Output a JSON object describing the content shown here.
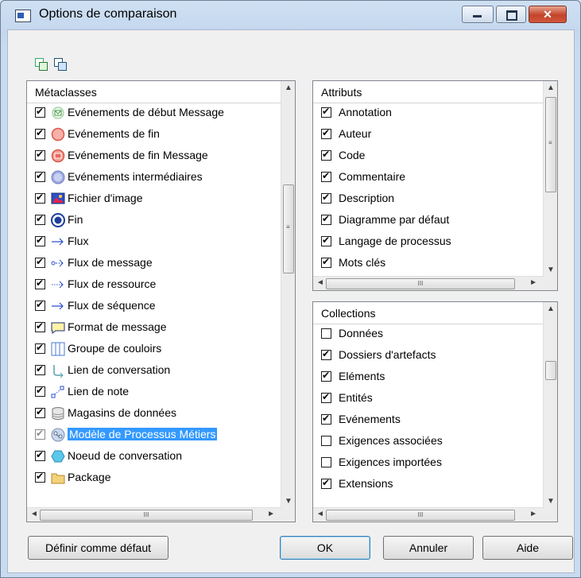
{
  "window": {
    "title": "Options de comparaison",
    "close_glyph": "✕"
  },
  "toolbar": {
    "icons": [
      "select-all-icon",
      "deselect-all-icon"
    ]
  },
  "metaclasses": {
    "header": "Métaclasses",
    "items": [
      {
        "label": "Evénements de début Message",
        "checked": true,
        "icon": "start-message-event-icon"
      },
      {
        "label": "Evénements de fin",
        "checked": true,
        "icon": "end-event-icon"
      },
      {
        "label": "Evénements de fin Message",
        "checked": true,
        "icon": "end-message-event-icon"
      },
      {
        "label": "Evénements intermédiaires",
        "checked": true,
        "icon": "intermediate-event-icon"
      },
      {
        "label": "Fichier d'image",
        "checked": true,
        "icon": "image-file-icon"
      },
      {
        "label": "Fin",
        "checked": true,
        "icon": "end-icon"
      },
      {
        "label": "Flux",
        "checked": true,
        "icon": "flow-arrow-icon"
      },
      {
        "label": "Flux de message",
        "checked": true,
        "icon": "message-flow-icon"
      },
      {
        "label": "Flux de ressource",
        "checked": true,
        "icon": "resource-flow-icon"
      },
      {
        "label": "Flux de séquence",
        "checked": true,
        "icon": "sequence-flow-icon"
      },
      {
        "label": "Format de message",
        "checked": true,
        "icon": "message-format-icon"
      },
      {
        "label": "Groupe de couloirs",
        "checked": true,
        "icon": "swimlane-group-icon"
      },
      {
        "label": "Lien de conversation",
        "checked": true,
        "icon": "conversation-link-icon"
      },
      {
        "label": "Lien de note",
        "checked": true,
        "icon": "note-link-icon"
      },
      {
        "label": "Magasins de données",
        "checked": true,
        "icon": "data-store-icon"
      },
      {
        "label": "Modèle de Processus Métiers",
        "checked": true,
        "icon": "business-process-model-icon"
      },
      {
        "label": "Noeud de conversation",
        "checked": true,
        "icon": "conversation-node-icon"
      },
      {
        "label": "Package",
        "checked": true,
        "icon": "package-folder-icon"
      }
    ],
    "selected_index": 15
  },
  "attributes": {
    "header": "Attributs",
    "items": [
      {
        "label": "Annotation",
        "checked": true
      },
      {
        "label": "Auteur",
        "checked": true
      },
      {
        "label": "Code",
        "checked": true
      },
      {
        "label": "Commentaire",
        "checked": true
      },
      {
        "label": "Description",
        "checked": true
      },
      {
        "label": "Diagramme par défaut",
        "checked": true
      },
      {
        "label": "Langage de processus",
        "checked": true
      },
      {
        "label": "Mots clés",
        "checked": true
      }
    ]
  },
  "collections": {
    "header": "Collections",
    "items": [
      {
        "label": "Données",
        "checked": false
      },
      {
        "label": "Dossiers d'artefacts",
        "checked": true
      },
      {
        "label": "Eléments",
        "checked": true
      },
      {
        "label": "Entités",
        "checked": true
      },
      {
        "label": "Evénements",
        "checked": true
      },
      {
        "label": "Exigences associées",
        "checked": false
      },
      {
        "label": "Exigences importées",
        "checked": false
      },
      {
        "label": "Extensions",
        "checked": true
      }
    ]
  },
  "buttons": {
    "set_default": "Définir comme défaut",
    "ok": "OK",
    "cancel": "Annuler",
    "help": "Aide"
  },
  "scroll_glyphs": {
    "up": "▲",
    "down": "▼",
    "left": "◄",
    "right": "►",
    "grip_v": "≡",
    "grip_h": "III"
  }
}
